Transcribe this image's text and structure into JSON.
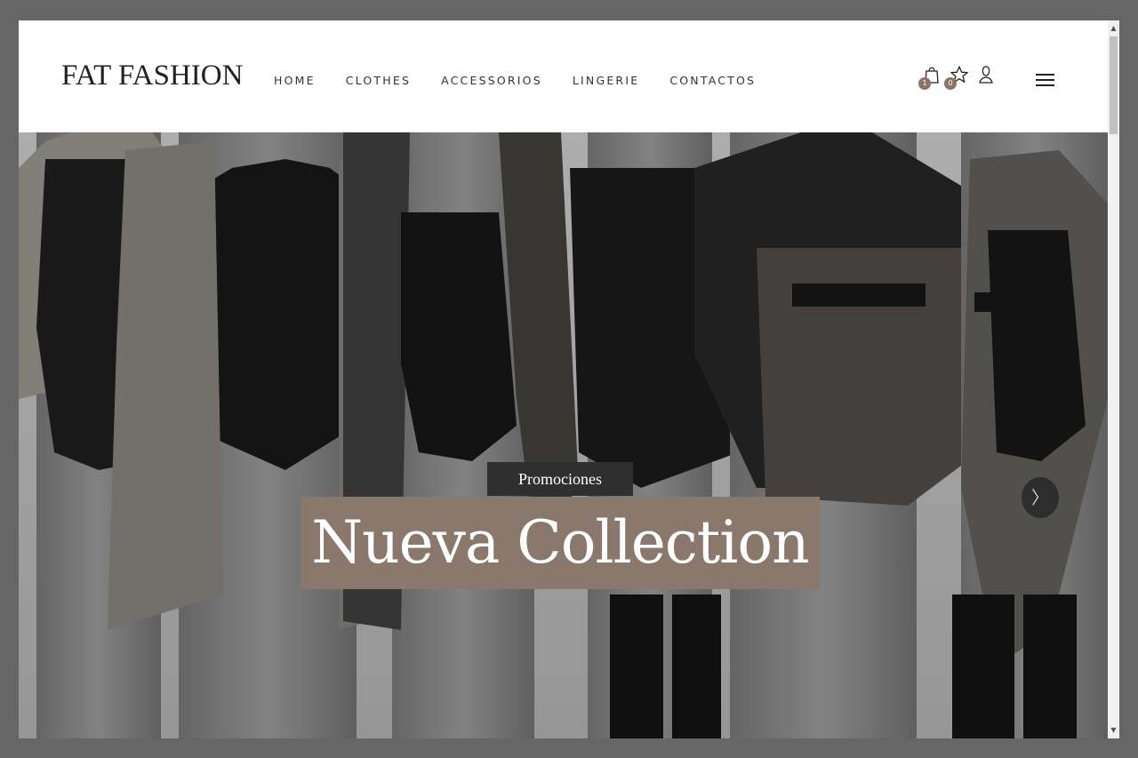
{
  "header": {
    "logo": "FAT FASHION",
    "nav": [
      {
        "label": "HOME"
      },
      {
        "label": "CLOTHES"
      },
      {
        "label": "ACCESSORIOS"
      },
      {
        "label": "LINGERIE"
      },
      {
        "label": "CONTACTOS"
      }
    ],
    "cart_count": "1",
    "wishlist_count": "0",
    "icons": [
      "shopping-bag-icon",
      "star-icon",
      "user-icon",
      "hamburger-menu-icon"
    ]
  },
  "hero": {
    "tag": "Promociones",
    "headline": "Nueva Collection",
    "next_arrow": "〉"
  },
  "scrollbar": {
    "up": "▲",
    "down": "▼"
  },
  "colors": {
    "accent": "#8b786d",
    "badge": "#8c7468",
    "tag_bg": "#2f2f2f",
    "frame": "#666666"
  }
}
